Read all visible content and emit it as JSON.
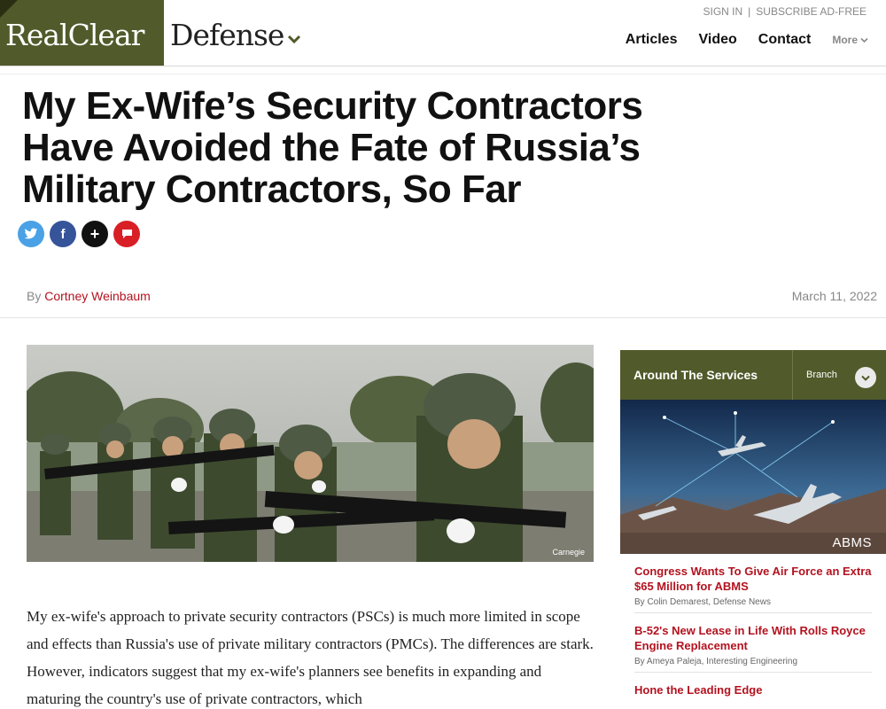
{
  "header": {
    "logo_main": "RealClear",
    "logo_section": "Defense",
    "sign_in": "SIGN IN",
    "separator": "|",
    "subscribe": "SUBSCRIBE AD-FREE",
    "nav": [
      {
        "label": "Articles"
      },
      {
        "label": "Video"
      },
      {
        "label": "Contact"
      }
    ],
    "more_label": "More"
  },
  "article": {
    "title": "My Ex-Wife’s Security Contractors Have Avoided the Fate of Russia’s Military Contractors, So Far",
    "byline_prefix": "By",
    "author": "Cortney Weinbaum",
    "date": "March 11, 2022",
    "photo_credit": "Carnegie",
    "body": "My ex-wife's approach to private security contractors (PSCs) is much more limited in scope and effects than Russia's use of private military contractors (PMCs). The differences are stark. However, indicators suggest that my ex-wife's planners see benefits in expanding and maturing the country's use of private contractors, which"
  },
  "share": {
    "twitter_glyph": "t",
    "facebook_glyph": "f",
    "more_glyph": "+",
    "comment_glyph": "■"
  },
  "sidebar": {
    "title": "Around The Services",
    "branch_label": "Branch",
    "image_label": "ABMS",
    "items": [
      {
        "title": "Congress Wants To Give Air Force an Extra $65 Million for ABMS",
        "byline": "By Colin Demarest, Defense News"
      },
      {
        "title": "B-52's New Lease in Life With Rolls Royce Engine Replacement",
        "byline": "By Ameya Paleja, Interesting Engineering"
      },
      {
        "title": "Hone the Leading Edge",
        "byline": ""
      }
    ]
  },
  "colors": {
    "brand_olive": "#515a2a",
    "link_red": "#b3121f",
    "twitter": "#4aa1e6",
    "facebook": "#36549a",
    "comment": "#d91f26"
  },
  "icons": [
    "chevron-down-icon",
    "twitter-icon",
    "facebook-icon",
    "plus-icon",
    "comment-icon"
  ]
}
